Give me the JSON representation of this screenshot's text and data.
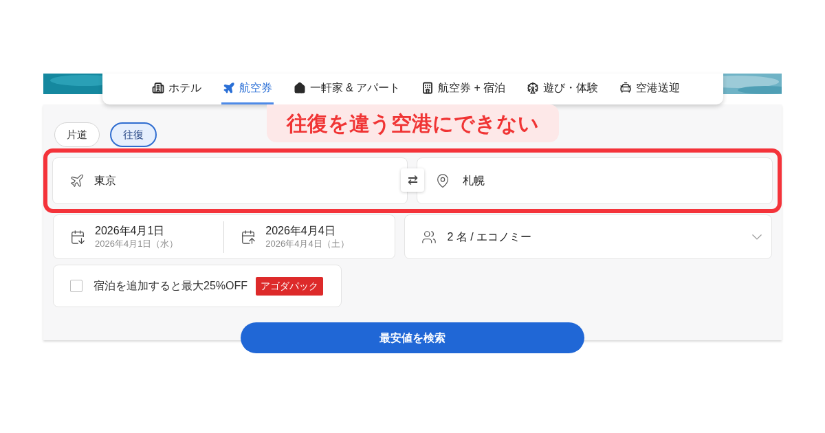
{
  "tabs": [
    {
      "kind": "hotel",
      "label": "ホテル",
      "selected": false
    },
    {
      "kind": "flight",
      "label": "航空券",
      "selected": true
    },
    {
      "kind": "home",
      "label": "一軒家 & アパート",
      "selected": false
    },
    {
      "kind": "package",
      "label": "航空券 + 宿泊",
      "selected": false
    },
    {
      "kind": "activity",
      "label": "遊び・体験",
      "selected": false
    },
    {
      "kind": "transfer",
      "label": "空港送迎",
      "selected": false
    }
  ],
  "annotation": "往復を違う空港にできない",
  "trip_types": [
    {
      "label": "片道",
      "selected": false
    },
    {
      "label": "往復",
      "selected": true
    }
  ],
  "origin": {
    "value": "東京"
  },
  "destination": {
    "value": "札幌"
  },
  "swap": {
    "glyph": "⇄"
  },
  "dates": [
    {
      "kind": "depart",
      "date": "2026年4月1日",
      "detail": "2026年4月1日（水）"
    },
    {
      "kind": "return",
      "date": "2026年4月4日",
      "detail": "2026年4月4日（土）"
    }
  ],
  "travelers": {
    "value": "2 名 / エコノミー"
  },
  "package": {
    "checked": false,
    "label": "宿泊を追加すると最大25%OFF",
    "badge": "アゴダパック"
  },
  "search_button": "最安値を検索"
}
